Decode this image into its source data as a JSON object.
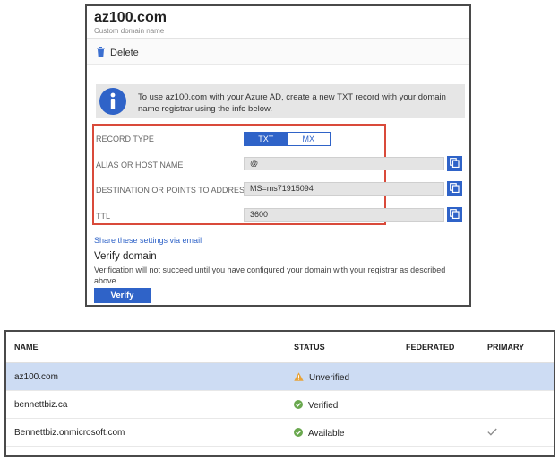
{
  "panel": {
    "title": "az100.com",
    "subtitle": "Custom domain name",
    "delete_label": "Delete",
    "info_text": "To use az100.com with your Azure AD, create a new TXT record with your domain name registrar using the info below.",
    "record_type_label": "RECORD TYPE",
    "record_type_options": [
      "TXT",
      "MX"
    ],
    "record_type_selected": "TXT",
    "alias_label": "ALIAS OR HOST NAME",
    "alias_value": "@",
    "destination_label": "DESTINATION OR POINTS TO ADDRESS",
    "destination_value": "MS=ms71915094",
    "ttl_label": "TTL",
    "ttl_value": "3600",
    "share_link": "Share these settings via email",
    "verify_heading": "Verify domain",
    "verify_desc": "Verification will not succeed until you have configured your domain with your registrar as described above.",
    "verify_button": "Verify",
    "colors": {
      "accent": "#2f63c8",
      "highlight_frame": "#d94a3a",
      "info_icon": "#2f63c8"
    }
  },
  "domains_table": {
    "columns": [
      "NAME",
      "STATUS",
      "FEDERATED",
      "PRIMARY"
    ],
    "rows": [
      {
        "name": "az100.com",
        "status": "Unverified",
        "status_icon": "warning-icon",
        "federated": "",
        "primary": false,
        "selected": true
      },
      {
        "name": "bennettbiz.ca",
        "status": "Verified",
        "status_icon": "check-circle-icon",
        "federated": "",
        "primary": false,
        "selected": false
      },
      {
        "name": "Bennettbiz.onmicrosoft.com",
        "status": "Available",
        "status_icon": "check-circle-icon",
        "federated": "",
        "primary": true,
        "selected": false
      }
    ],
    "colors": {
      "selected_row": "#cddcf3",
      "warning": "#e8a43a",
      "ok": "#6aa84f",
      "checkmark": "#8a8a8a"
    }
  }
}
